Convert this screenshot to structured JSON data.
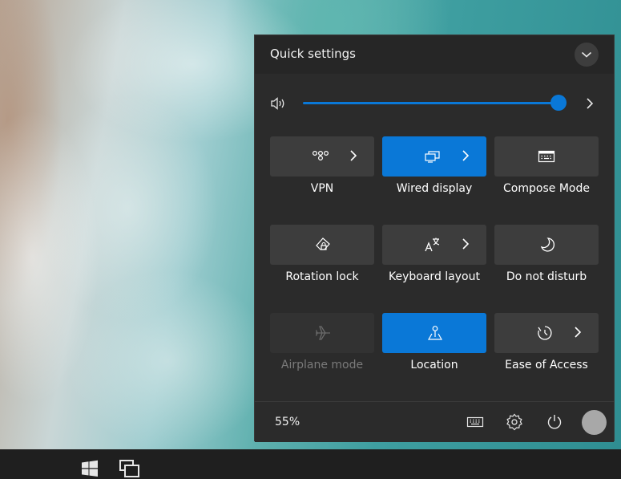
{
  "panel": {
    "title": "Quick settings",
    "volume": {
      "level": 1.0,
      "icon": "speaker-icon"
    },
    "tiles": [
      {
        "label": "VPN",
        "icon": "vpn-icon",
        "state": "off",
        "expandable": true
      },
      {
        "label": "Wired display",
        "icon": "display-icon",
        "state": "on",
        "expandable": true
      },
      {
        "label": "Compose Mode",
        "icon": "keyboard-icon",
        "state": "off",
        "expandable": false
      },
      {
        "label": "Rotation lock",
        "icon": "rotation-lock-icon",
        "state": "off",
        "expandable": false
      },
      {
        "label": "Keyboard layout",
        "icon": "keyboard-layout-icon",
        "state": "off",
        "expandable": true
      },
      {
        "label": "Do not disturb",
        "icon": "moon-icon",
        "state": "off",
        "expandable": false
      },
      {
        "label": "Airplane mode",
        "icon": "airplane-icon",
        "state": "disabled",
        "expandable": false
      },
      {
        "label": "Location",
        "icon": "location-icon",
        "state": "on",
        "expandable": false
      },
      {
        "label": "Ease of Access",
        "icon": "accessibility-icon",
        "state": "off",
        "expandable": true
      }
    ],
    "footer": {
      "battery": "55%"
    }
  },
  "colors": {
    "accent": "#0a78d7",
    "tile": "#3d3d3d",
    "panel": "#2b2b2b"
  }
}
